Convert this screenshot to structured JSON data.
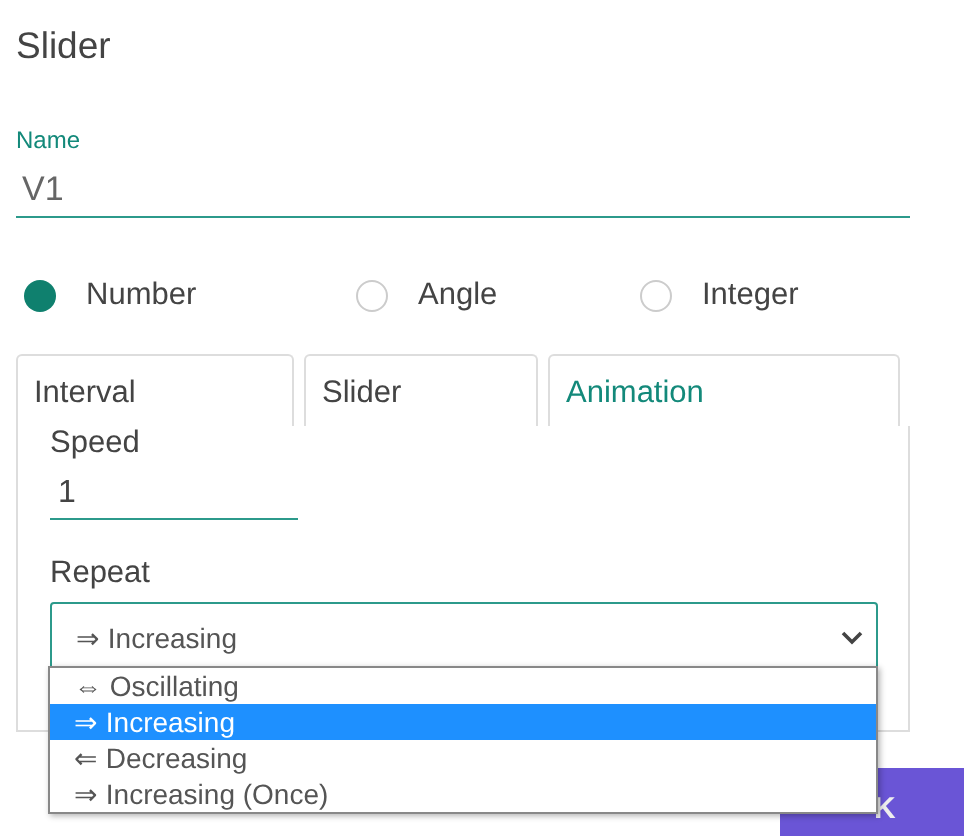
{
  "title": "Slider",
  "name_field": {
    "label": "Name",
    "value": "V1"
  },
  "types": [
    {
      "label": "Number",
      "selected": true
    },
    {
      "label": "Angle",
      "selected": false
    },
    {
      "label": "Integer",
      "selected": false
    }
  ],
  "tabs": [
    {
      "label": "Interval",
      "selected": false
    },
    {
      "label": "Slider",
      "selected": false
    },
    {
      "label": "Animation",
      "selected": true
    }
  ],
  "speed": {
    "label": "Speed",
    "value": "1"
  },
  "repeat": {
    "label": "Repeat",
    "value": "⇒ Increasing",
    "expanded": true,
    "options": [
      {
        "label": "⇔ Oscillating",
        "selected": false
      },
      {
        "label": "⇒ Increasing",
        "selected": true
      },
      {
        "label": "⇐ Decreasing",
        "selected": false
      },
      {
        "label": "⇒ Increasing (Once)",
        "selected": false
      }
    ]
  },
  "ok_button": {
    "label": "K"
  }
}
